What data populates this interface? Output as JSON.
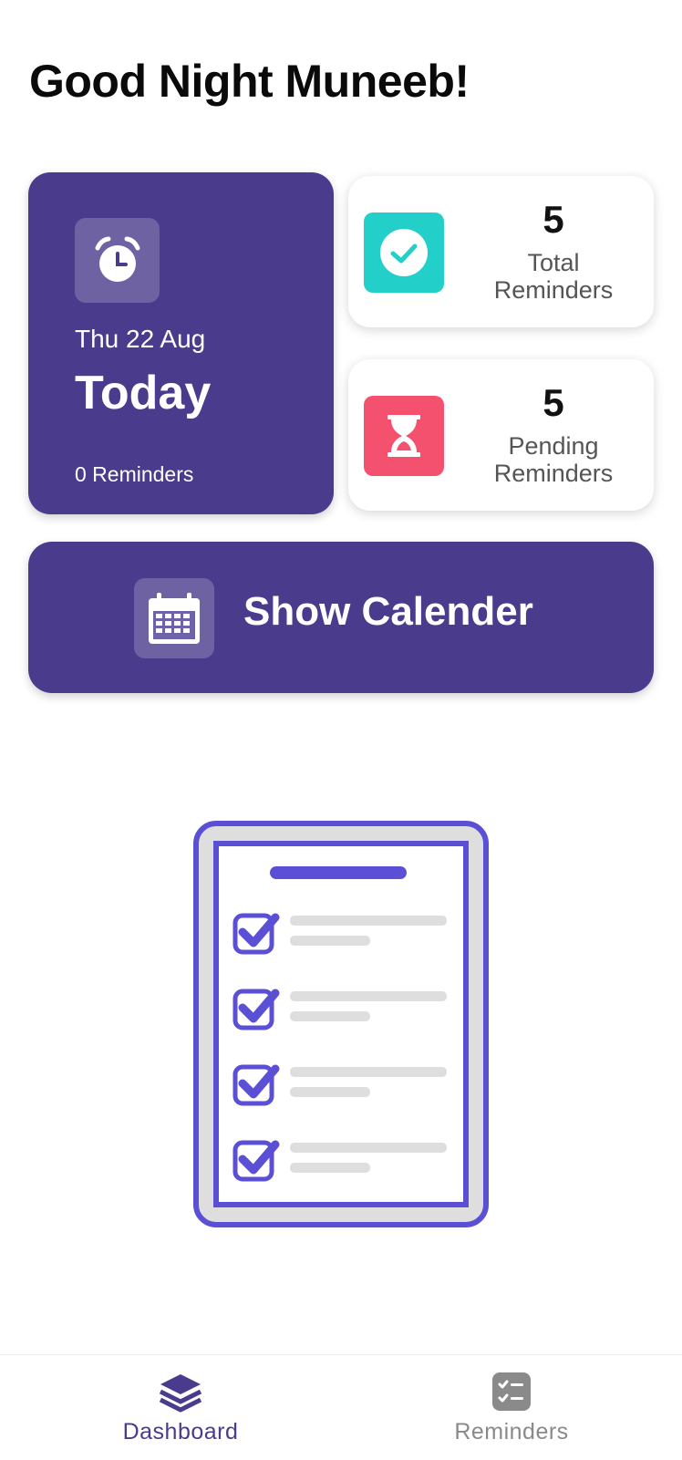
{
  "greeting": "Good Night Muneeb!",
  "today_card": {
    "date": "Thu 22 Aug",
    "label": "Today",
    "count": "0 Reminders",
    "icon": "alarm-clock-icon"
  },
  "stats": {
    "total": {
      "value": "5",
      "label_line1": "Total",
      "label_line2": "Reminders",
      "icon": "check-circle-icon",
      "color": "#22d0c9"
    },
    "pending": {
      "value": "5",
      "label_line1": "Pending",
      "label_line2": "Reminders",
      "icon": "hourglass-icon",
      "color": "#f4516e"
    }
  },
  "calendar_button": {
    "label": "Show Calender",
    "icon": "calendar-icon"
  },
  "bottom_nav": {
    "items": [
      {
        "label": "Dashboard",
        "icon": "layers-icon",
        "active": true
      },
      {
        "label": "Reminders",
        "icon": "checklist-icon",
        "active": false
      }
    ]
  },
  "colors": {
    "primary": "#4a3b8c",
    "accent_teal": "#22d0c9",
    "accent_pink": "#f4516e",
    "illustration": "#5b4fd6"
  }
}
